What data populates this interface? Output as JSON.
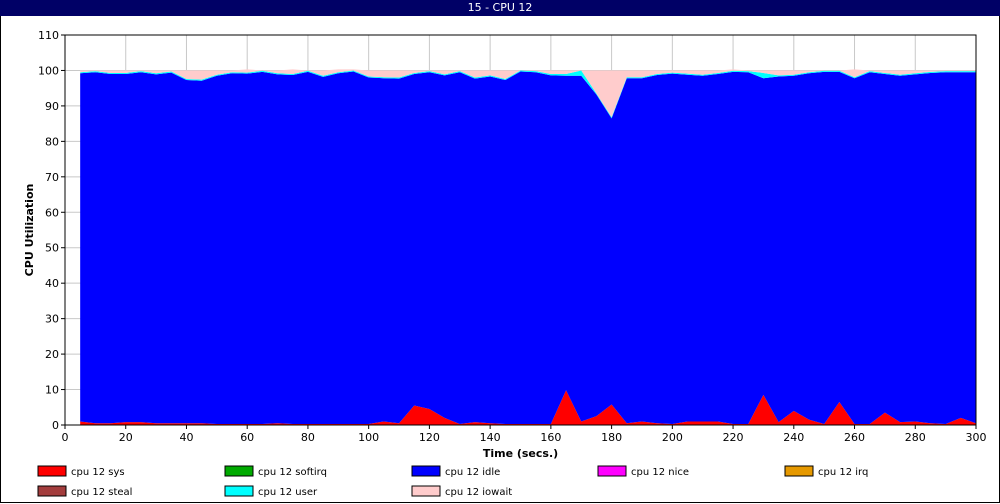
{
  "window": {
    "title": "15 - CPU 12"
  },
  "chart_data": {
    "type": "area",
    "stacked": true,
    "xlabel": "Time (secs.)",
    "ylabel": "CPU Utilization",
    "xlim": [
      0,
      300
    ],
    "ylim": [
      0,
      110
    ],
    "xticks": [
      0,
      20,
      40,
      60,
      80,
      100,
      120,
      140,
      160,
      180,
      200,
      220,
      240,
      260,
      280,
      300
    ],
    "yticks": [
      0,
      10,
      20,
      30,
      40,
      50,
      60,
      70,
      80,
      90,
      100,
      110
    ],
    "grid": true,
    "legend_position": "bottom",
    "x": [
      5,
      10,
      15,
      20,
      25,
      30,
      35,
      40,
      45,
      50,
      55,
      60,
      65,
      70,
      75,
      80,
      85,
      90,
      95,
      100,
      105,
      110,
      115,
      120,
      125,
      130,
      135,
      140,
      145,
      150,
      155,
      160,
      165,
      170,
      175,
      180,
      185,
      190,
      195,
      200,
      205,
      210,
      215,
      220,
      225,
      230,
      235,
      240,
      245,
      250,
      255,
      260,
      265,
      270,
      275,
      280,
      285,
      290,
      295,
      300
    ],
    "series": [
      {
        "name": "cpu 12 sys",
        "color": "#ff0000",
        "values": [
          1.0,
          0.5,
          0.5,
          0.8,
          0.8,
          0.5,
          0.5,
          0.5,
          0.5,
          0.3,
          0.3,
          0.3,
          0.3,
          0.5,
          0.3,
          0.3,
          0.3,
          0.3,
          0.3,
          0.3,
          1.0,
          0.5,
          5.5,
          4.5,
          2.0,
          0.3,
          0.8,
          0.5,
          0.3,
          0.3,
          0.3,
          0.3,
          9.8,
          1.0,
          2.5,
          5.8,
          0.5,
          1.0,
          0.5,
          0.3,
          1.0,
          1.0,
          1.0,
          0.3,
          0.3,
          8.5,
          0.8,
          4.0,
          1.5,
          0.3,
          6.5,
          0.3,
          0.3,
          3.5,
          0.8,
          1.0,
          0.5,
          0.3,
          2.0,
          0.5
        ]
      },
      {
        "name": "cpu 12 softirq",
        "color": "#00aa00",
        "values": []
      },
      {
        "name": "cpu 12 idle",
        "color": "#0000ff",
        "values": [
          98.2,
          99.0,
          98.5,
          98.2,
          98.7,
          98.4,
          98.9,
          96.8,
          96.6,
          98.2,
          98.9,
          98.8,
          99.3,
          98.4,
          98.4,
          99.3,
          97.9,
          98.9,
          99.4,
          97.7,
          96.8,
          97.2,
          93.5,
          95.0,
          96.6,
          99.2,
          96.9,
          97.8,
          97.0,
          99.4,
          99.2,
          98.3,
          88.7,
          97.5,
          90.7,
          80.7,
          97.3,
          96.8,
          98.2,
          98.8,
          97.8,
          97.5,
          98.0,
          99.3,
          99.2,
          89.3,
          97.5,
          94.5,
          97.7,
          99.3,
          93.1,
          97.5,
          99.2,
          95.5,
          97.7,
          97.9,
          98.8,
          99.2,
          97.5,
          99.0
        ]
      },
      {
        "name": "cpu 12 nice",
        "color": "#ff00ff",
        "values": []
      },
      {
        "name": "cpu 12 irq",
        "color": "#e69900",
        "values": []
      },
      {
        "name": "cpu 12 steal",
        "color": "#a33d3d",
        "values": []
      },
      {
        "name": "cpu 12 user",
        "color": "#00ffff",
        "values": [
          0.3,
          0.3,
          0.3,
          0.3,
          0.3,
          0.3,
          0.3,
          0.3,
          0.3,
          0.3,
          0.3,
          0.3,
          0.3,
          0.3,
          0.3,
          0.3,
          0.3,
          0.3,
          0.3,
          0.3,
          0.3,
          0.3,
          0.3,
          0.3,
          0.3,
          0.3,
          0.3,
          0.3,
          0.3,
          0.3,
          0.3,
          0.4,
          0.5,
          1.5,
          0.3,
          0.3,
          0.3,
          0.3,
          0.3,
          0.3,
          0.3,
          0.3,
          0.3,
          0.3,
          0.3,
          1.5,
          0.3,
          0.3,
          0.3,
          0.3,
          0.3,
          0.3,
          0.3,
          0.3,
          0.3,
          0.3,
          0.3,
          0.3,
          0.3,
          0.3
        ]
      },
      {
        "name": "cpu 12 iowait",
        "color": "#ffcccc",
        "values": [
          0.5,
          0.2,
          0.7,
          0.7,
          0.2,
          0.8,
          0.3,
          2.4,
          2.6,
          1.2,
          0.5,
          0.9,
          0.1,
          0.8,
          1.3,
          0.1,
          1.5,
          0.8,
          0.3,
          1.7,
          1.9,
          2.0,
          0.7,
          0.2,
          1.1,
          0.2,
          2.0,
          1.4,
          2.4,
          0.0,
          0.2,
          1.0,
          1.0,
          0.0,
          6.5,
          13.2,
          1.9,
          1.9,
          1.0,
          0.6,
          0.9,
          1.2,
          0.7,
          0.4,
          0.2,
          0.7,
          1.4,
          1.2,
          0.5,
          0.1,
          0.1,
          2.2,
          0.2,
          0.7,
          1.2,
          0.8,
          0.4,
          0.2,
          0.2,
          0.2
        ]
      }
    ]
  }
}
